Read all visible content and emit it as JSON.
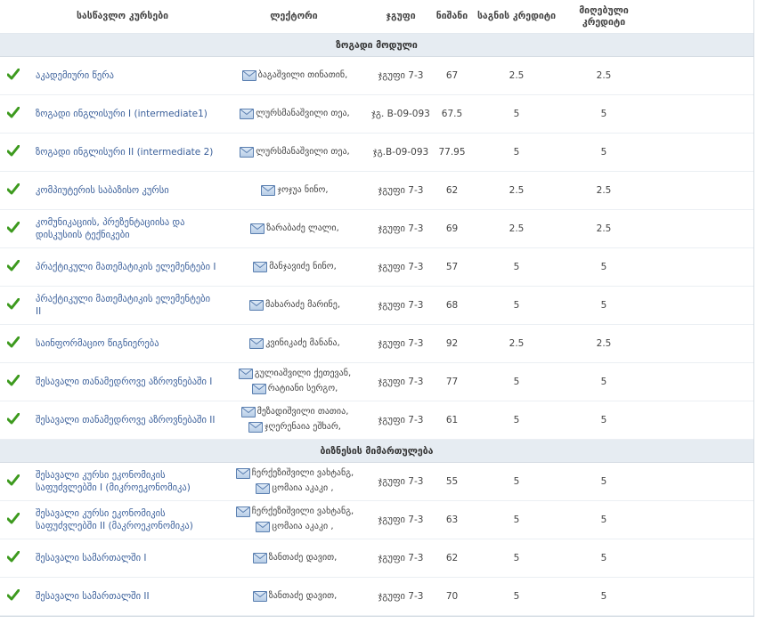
{
  "headers": {
    "course": "სასწავლო კურსები",
    "lecturer": "ლექტორი",
    "group": "ჯგუფი",
    "grade": "ნიშანი",
    "subject_credits": "საგნის კრედიტი",
    "earned_credits": "მიღებული კრედიტი"
  },
  "sections": [
    {
      "title": "ზოგადი მოდული",
      "rows": [
        {
          "course": "აკადემიური წერა",
          "lecturers": [
            "ბაგაშვილი თინათინ,"
          ],
          "group": "ჯგუფი 7-3",
          "grade": "67",
          "subject_credits": "2.5",
          "earned_credits": "2.5"
        },
        {
          "course": "ზოგადი ინგლისური I (intermediate1)",
          "lecturers": [
            "ლურსმანაშვილი თეა,"
          ],
          "group": "ჯგ. B-09-093",
          "grade": "67.5",
          "subject_credits": "5",
          "earned_credits": "5"
        },
        {
          "course": "ზოგადი ინგლისური II (intermediate 2)",
          "lecturers": [
            "ლურსმანაშვილი თეა,"
          ],
          "group": "ჯგ.B-09-093",
          "grade": "77.95",
          "subject_credits": "5",
          "earned_credits": "5"
        },
        {
          "course": "კომპიუტერის საბაზისო კურსი",
          "lecturers": [
            "ჯოჯუა ნინო,"
          ],
          "group": "ჯგუფი 7-3",
          "grade": "62",
          "subject_credits": "2.5",
          "earned_credits": "2.5"
        },
        {
          "course": "კომუნიკაციის, პრეზენტაციისა და დისკუსიის ტექნიკები",
          "lecturers": [
            "ზარაბაძე ლალი,"
          ],
          "group": "ჯგუფი 7-3",
          "grade": "69",
          "subject_credits": "2.5",
          "earned_credits": "2.5"
        },
        {
          "course": "პრაქტიკული მათემატიკის ელემენტები I",
          "lecturers": [
            "მანჯავიძე ნინო,"
          ],
          "group": "ჯგუფი 7-3",
          "grade": "57",
          "subject_credits": "5",
          "earned_credits": "5"
        },
        {
          "course": "პრაქტიკული მათემატიკის ელემენტები II",
          "lecturers": [
            "მახარაძე მარინე,"
          ],
          "group": "ჯგუფი 7-3",
          "grade": "68",
          "subject_credits": "5",
          "earned_credits": "5"
        },
        {
          "course": "საინფორმაციო წიგნიერება",
          "lecturers": [
            "კვინიკაძე მანანა,"
          ],
          "group": "ჯგუფი 7-3",
          "grade": "92",
          "subject_credits": "2.5",
          "earned_credits": "2.5"
        },
        {
          "course": "შესავალი თანამედროვე აზროვნებაში I",
          "lecturers": [
            "გულიაშვილი ქეთევან,",
            "რატიანი სერგო,"
          ],
          "group": "ჯგუფი 7-3",
          "grade": "77",
          "subject_credits": "5",
          "earned_credits": "5"
        },
        {
          "course": "შესავალი თანამედროვე აზროვნებაში II",
          "lecturers": [
            "მეზადიშვილი თათია,",
            "ჯღერენაია ეშხარ,"
          ],
          "group": "ჯგუფი 7-3",
          "grade": "61",
          "subject_credits": "5",
          "earned_credits": "5"
        }
      ]
    },
    {
      "title": "ბიზნესის მიმართულება",
      "rows": [
        {
          "course": "შესავალი კურსი ეკონომიკის საფუძვლებში I (მიკროეკონომიკა)",
          "lecturers": [
            "ჩერქეზიშვილი ვახტანგ,",
            "ცომაია აკაკი ,"
          ],
          "group": "ჯგუფი 7-3",
          "grade": "55",
          "subject_credits": "5",
          "earned_credits": "5"
        },
        {
          "course": "შესავალი კურსი ეკონომიკის საფუძვლებში II (მაკროეკონომიკა)",
          "lecturers": [
            "ჩერქეზიშვილი ვახტანგ,",
            "ცომაია აკაკი ,"
          ],
          "group": "ჯგუფი 7-3",
          "grade": "63",
          "subject_credits": "5",
          "earned_credits": "5"
        },
        {
          "course": "შესავალი სამართალში I",
          "lecturers": [
            "ზანთაძე დავით,"
          ],
          "group": "ჯგუფი 7-3",
          "grade": "62",
          "subject_credits": "5",
          "earned_credits": "5"
        },
        {
          "course": "შესავალი სამართალში II",
          "lecturers": [
            "ზანთაძე დავით,"
          ],
          "group": "ჯგუფი 7-3",
          "grade": "70",
          "subject_credits": "5",
          "earned_credits": "5"
        }
      ]
    }
  ],
  "icons": {
    "completed": "check-icon",
    "mail": "envelope-icon"
  },
  "colors": {
    "check": "#3d9a1e",
    "link": "#3a5f9a",
    "section_bg": "#e6ecf2"
  }
}
